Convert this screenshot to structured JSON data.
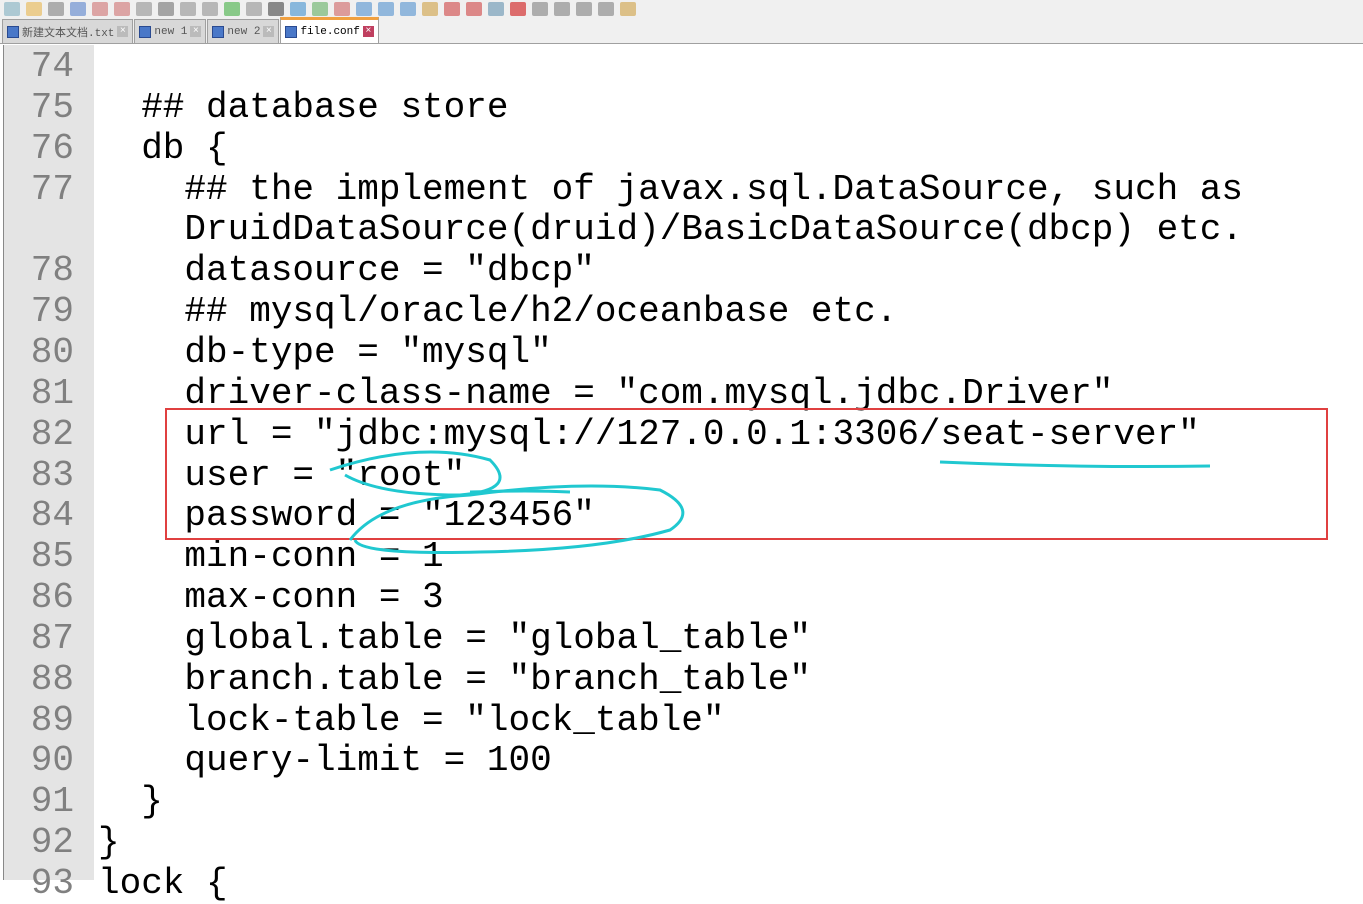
{
  "tabs": [
    {
      "label": "新建文本文档.txt",
      "active": false
    },
    {
      "label": "new 1",
      "active": false
    },
    {
      "label": "new 2",
      "active": false
    },
    {
      "label": "file.conf",
      "active": true
    }
  ],
  "lines": [
    {
      "n": "74",
      "text": ""
    },
    {
      "n": "75",
      "text": "  ## database store"
    },
    {
      "n": "76",
      "text": "  db {"
    },
    {
      "n": "77",
      "text": "    ## the implement of javax.sql.DataSource, such as"
    },
    {
      "n": "",
      "text": "    DruidDataSource(druid)/BasicDataSource(dbcp) etc."
    },
    {
      "n": "78",
      "text": "    datasource = \"dbcp\""
    },
    {
      "n": "79",
      "text": "    ## mysql/oracle/h2/oceanbase etc."
    },
    {
      "n": "80",
      "text": "    db-type = \"mysql\""
    },
    {
      "n": "81",
      "text": "    driver-class-name = \"com.mysql.jdbc.Driver\""
    },
    {
      "n": "82",
      "text": "    url = \"jdbc:mysql://127.0.0.1:3306/seat-server\""
    },
    {
      "n": "83",
      "text": "    user = \"root\""
    },
    {
      "n": "84",
      "text": "    password = \"123456\""
    },
    {
      "n": "85",
      "text": "    min-conn = 1"
    },
    {
      "n": "86",
      "text": "    max-conn = 3"
    },
    {
      "n": "87",
      "text": "    global.table = \"global_table\""
    },
    {
      "n": "88",
      "text": "    branch.table = \"branch_table\""
    },
    {
      "n": "89",
      "text": "    lock-table = \"lock_table\""
    },
    {
      "n": "90",
      "text": "    query-limit = 100"
    },
    {
      "n": "91",
      "text": "  }"
    },
    {
      "n": "92",
      "text": "}"
    },
    {
      "n": "93",
      "text": "lock {"
    }
  ],
  "colors": {
    "highlight_box": "#e04040",
    "annotation": "#20c8d0"
  }
}
